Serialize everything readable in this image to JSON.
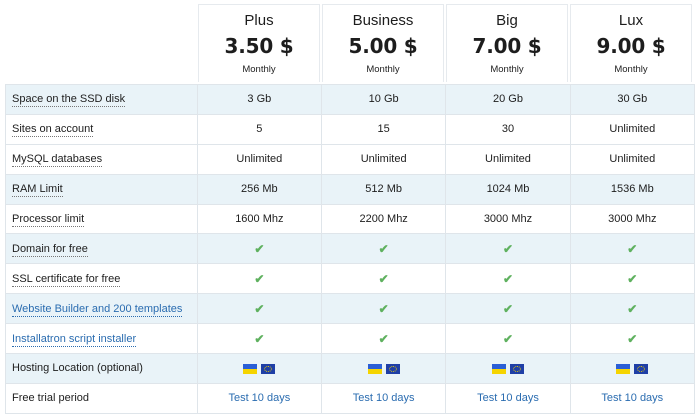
{
  "plans": [
    {
      "name": "Plus",
      "price": "3.50 $",
      "period": "Monthly"
    },
    {
      "name": "Business",
      "price": "5.00 $",
      "period": "Monthly"
    },
    {
      "name": "Big",
      "price": "7.00 $",
      "period": "Monthly"
    },
    {
      "name": "Lux",
      "price": "9.00 $",
      "period": "Monthly"
    }
  ],
  "rows": [
    {
      "label": "Space on the SSD disk",
      "values": [
        "3 Gb",
        "10 Gb",
        "20 Gb",
        "30 Gb"
      ]
    },
    {
      "label": "Sites on account",
      "values": [
        "5",
        "15",
        "30",
        "Unlimited"
      ]
    },
    {
      "label": "MySQL databases",
      "values": [
        "Unlimited",
        "Unlimited",
        "Unlimited",
        "Unlimited"
      ]
    },
    {
      "label": "RAM Limit",
      "values": [
        "256 Mb",
        "512 Mb",
        "1024 Mb",
        "1536 Mb"
      ]
    },
    {
      "label": "Processor limit",
      "values": [
        "1600 Mhz",
        "2200 Mhz",
        "3000 Mhz",
        "3000 Mhz"
      ]
    },
    {
      "label": "Domain for free",
      "values": [
        "✔",
        "✔",
        "✔",
        "✔"
      ]
    },
    {
      "label": "SSL certificate for free",
      "values": [
        "✔",
        "✔",
        "✔",
        "✔"
      ]
    },
    {
      "label": "Website Builder and 200 templates",
      "values": [
        "✔",
        "✔",
        "✔",
        "✔"
      ]
    },
    {
      "label": "Installatron script installer",
      "values": [
        "✔",
        "✔",
        "✔",
        "✔"
      ]
    },
    {
      "label": "Hosting Location (optional)",
      "values": [
        "",
        "",
        "",
        ""
      ]
    },
    {
      "label": "Free trial period",
      "values": [
        "Test 10 days",
        "Test 10 days",
        "Test 10 days",
        "Test 10 days"
      ]
    }
  ],
  "icons": {
    "check": "checkmark-icon",
    "flag_ua": "ukraine-flag-icon",
    "flag_eu": "eu-flag-icon"
  },
  "colors": {
    "check": "#5fb15f",
    "link": "#2a6cb0",
    "row_alt": "#e9f3f8"
  }
}
